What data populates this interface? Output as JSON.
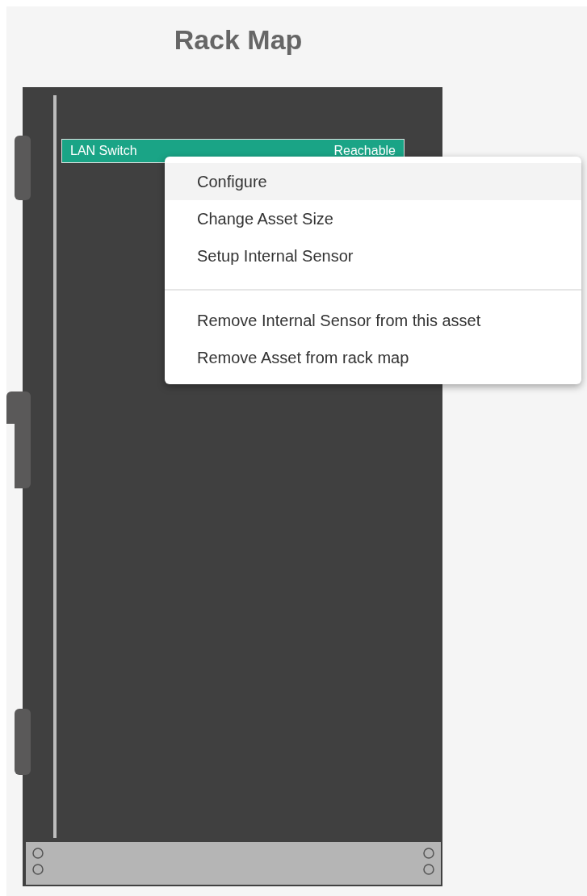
{
  "title": "Rack Map",
  "rack": {
    "devices": [
      {
        "name": "LAN Switch",
        "status": "Reachable"
      }
    ]
  },
  "context_menu": {
    "groups": [
      [
        {
          "label": "Configure",
          "selected": true
        },
        {
          "label": "Change Asset Size",
          "selected": false
        },
        {
          "label": "Setup Internal Sensor",
          "selected": false
        }
      ],
      [
        {
          "label": "Remove Internal Sensor from this asset",
          "selected": false
        },
        {
          "label": "Remove Asset from rack map",
          "selected": false
        }
      ]
    ]
  }
}
